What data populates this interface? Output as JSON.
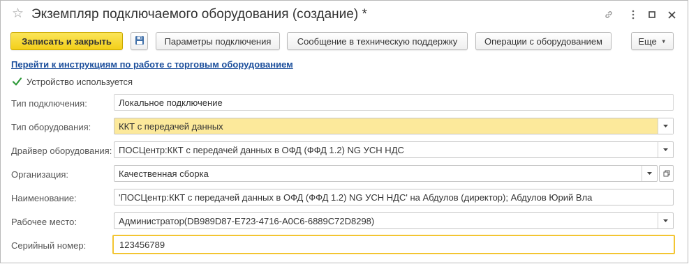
{
  "window": {
    "title": "Экземпляр подключаемого оборудования (создание) *",
    "icons": {
      "favorite": "star-icon",
      "link": "link-icon",
      "more": "vertical-dots-icon",
      "maximize": "maximize-icon",
      "close": "close-icon"
    }
  },
  "toolbar": {
    "save_close_label": "Записать и закрыть",
    "save_icon": "floppy-disk-icon",
    "connection_params_label": "Параметры подключения",
    "support_message_label": "Сообщение в техническую поддержку",
    "equipment_ops_label": "Операции с оборудованием",
    "more_label": "Еще",
    "accent_color": "#f3cf19"
  },
  "instructions_link": "Перейти к инструкциям по работе с торговым оборудованием",
  "device_in_use": {
    "label": "Устройство используется",
    "checked": true
  },
  "form": {
    "connection_type": {
      "label": "Тип подключения:",
      "value": "Локальное подключение"
    },
    "equipment_type": {
      "label": "Тип оборудования:",
      "value": "ККТ с передачей данных"
    },
    "equipment_driver": {
      "label": "Драйвер оборудования:",
      "value": "ПОСЦентр:ККТ с передачей данных в ОФД (ФФД 1.2) NG УСН НДС"
    },
    "organization": {
      "label": "Организация:",
      "value": "Качественная сборка"
    },
    "name": {
      "label": "Наименование:",
      "value": "'ПОСЦентр:ККТ с передачей данных в ОФД (ФФД 1.2) NG УСН НДС' на Абдулов (директор); Абдулов Юрий Вла"
    },
    "workplace": {
      "label": "Рабочее место:",
      "value": "Администратор(DB989D87-E723-4716-A0C6-6889C72D8298)"
    },
    "serial_number": {
      "label": "Серийный номер:",
      "value": "123456789"
    }
  }
}
